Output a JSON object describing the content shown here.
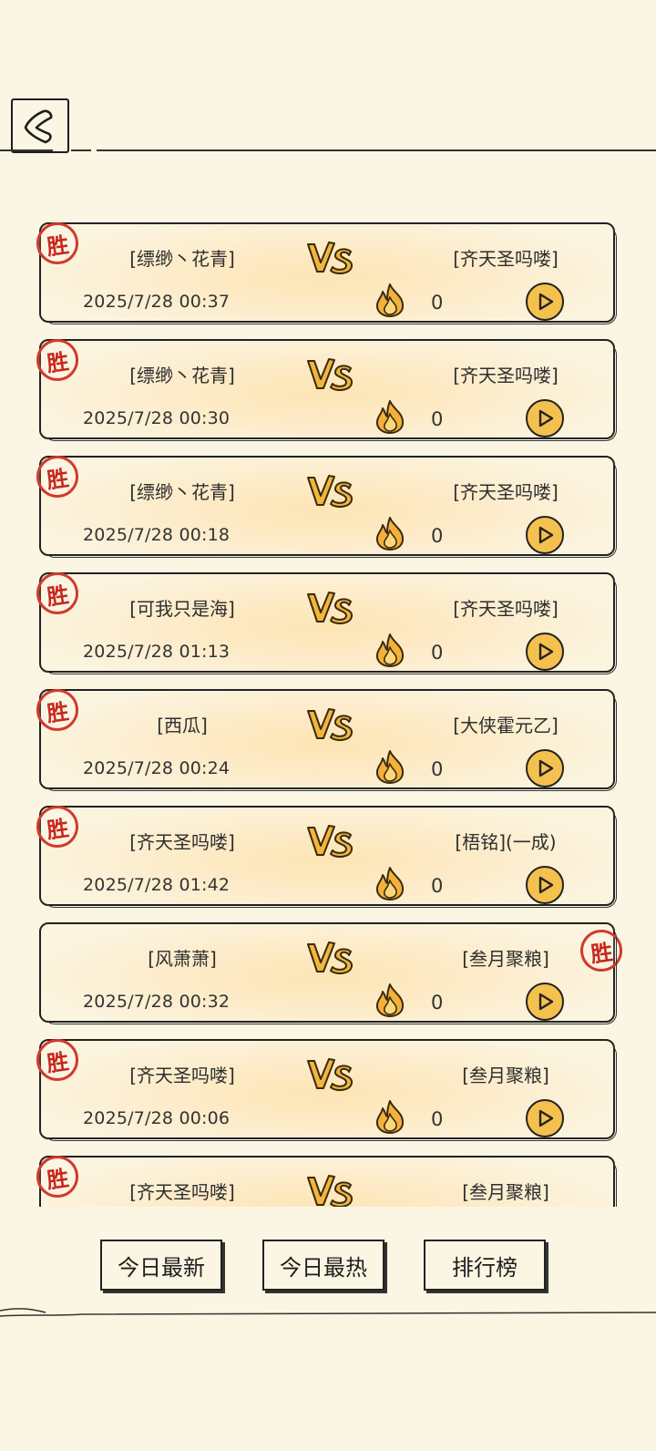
{
  "header": {
    "back_icon": "back-chevron-icon"
  },
  "matches": [
    {
      "left": "[缥缈丶花青]",
      "right": "[齐天圣吗喽]",
      "time": "2025/7/28 00:37",
      "heat": "0",
      "winner": "left"
    },
    {
      "left": "[缥缈丶花青]",
      "right": "[齐天圣吗喽]",
      "time": "2025/7/28 00:30",
      "heat": "0",
      "winner": "left"
    },
    {
      "left": "[缥缈丶花青]",
      "right": "[齐天圣吗喽]",
      "time": "2025/7/28 00:18",
      "heat": "0",
      "winner": "left"
    },
    {
      "left": "[可我只是海]",
      "right": "[齐天圣吗喽]",
      "time": "2025/7/28 01:13",
      "heat": "0",
      "winner": "left"
    },
    {
      "left": "[西瓜]",
      "right": "[大侠霍元乙]",
      "time": "2025/7/28 00:24",
      "heat": "0",
      "winner": "left"
    },
    {
      "left": "[齐天圣吗喽]",
      "right": "[梧铭](一成)",
      "time": "2025/7/28 01:42",
      "heat": "0",
      "winner": "left"
    },
    {
      "left": "[风萧萧]",
      "right": "[叁月聚粮]",
      "time": "2025/7/28 00:32",
      "heat": "0",
      "winner": "right"
    },
    {
      "left": "[齐天圣吗喽]",
      "right": "[叁月聚粮]",
      "time": "2025/7/28 00:06",
      "heat": "0",
      "winner": "left"
    },
    {
      "left": "[齐天圣吗喽]",
      "right": "[叁月聚粮]",
      "time": "",
      "heat": "",
      "winner": "left"
    }
  ],
  "labels": {
    "win": "胜",
    "vs": "VS"
  },
  "tabs": {
    "today_latest": "今日最新",
    "today_hot": "今日最热",
    "ranking": "排行榜"
  },
  "colors": {
    "accent": "#f5c14e",
    "stamp": "#d23a2e",
    "background": "#fbf6e3"
  }
}
